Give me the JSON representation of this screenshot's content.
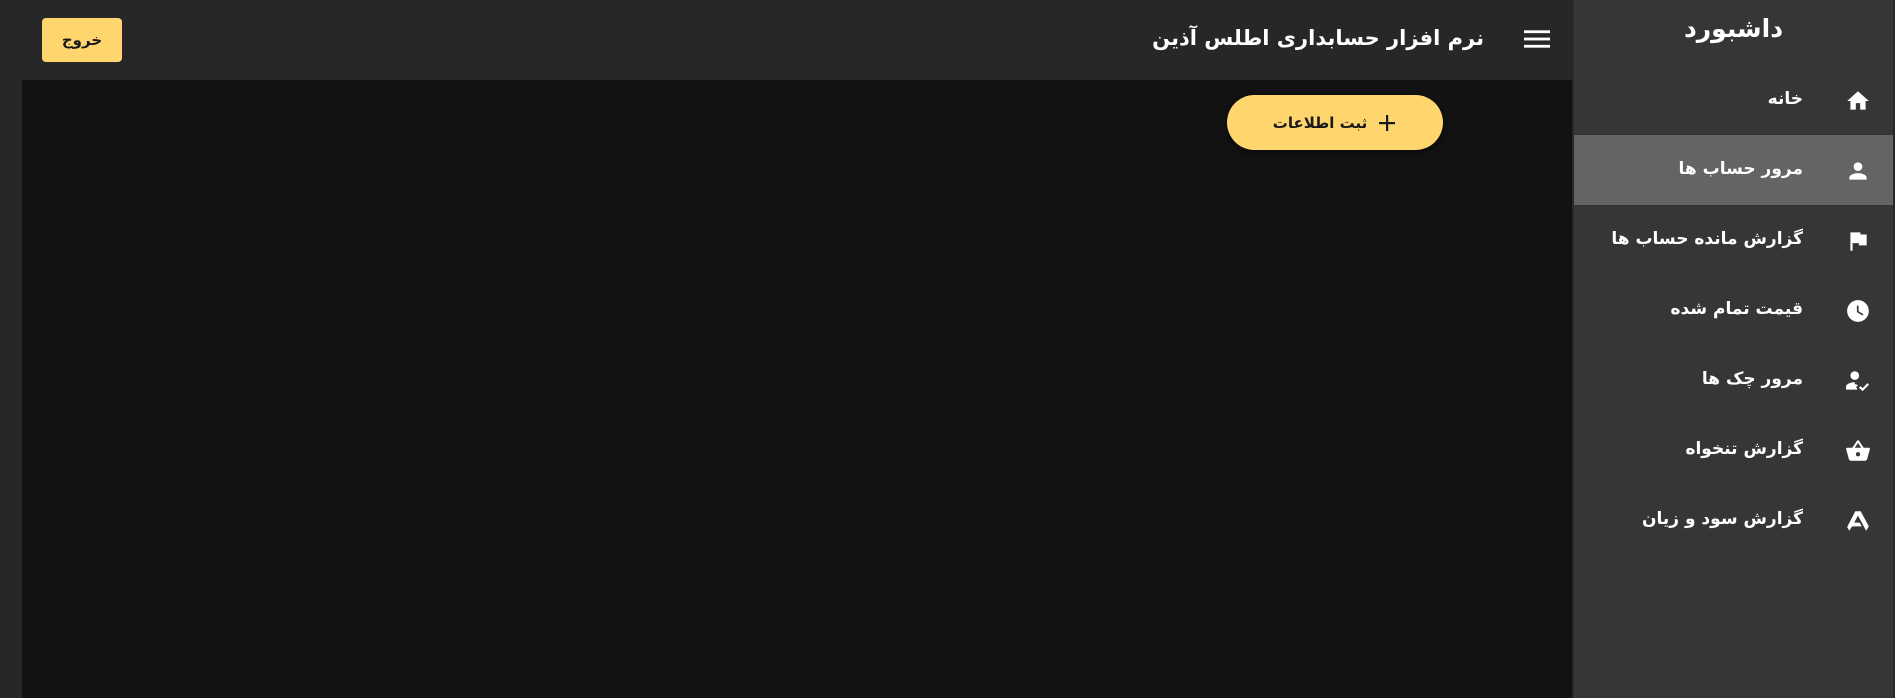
{
  "sidebar": {
    "title": "داشبورد",
    "items": [
      {
        "label": "خانه",
        "icon": "home-icon",
        "active": false
      },
      {
        "label": "مرور حساب ها",
        "icon": "person-icon",
        "active": true
      },
      {
        "label": "گزارش مانده حساب ها",
        "icon": "flag-icon",
        "active": false
      },
      {
        "label": "قیمت تمام شده",
        "icon": "clock-icon",
        "active": false
      },
      {
        "label": "مرور چک ها",
        "icon": "person-check-icon",
        "active": false
      },
      {
        "label": "گزارش تنخواه",
        "icon": "basket-icon",
        "active": false
      },
      {
        "label": "گزارش سود و زیان",
        "icon": "triangle-logo-icon",
        "active": false
      }
    ]
  },
  "header": {
    "title": "نرم افزار حسابداری اطلس آذین",
    "menu_icon": "hamburger-menu-icon",
    "logout_label": "خروج"
  },
  "main": {
    "add_button_label": "ثبت اطلاعات",
    "add_button_icon": "plus-icon"
  },
  "colors": {
    "accent": "#ffd66e",
    "sidebar_bg": "#363636",
    "active_item_bg": "#646464",
    "topbar_bg": "#272727",
    "main_bg": "#121212"
  }
}
